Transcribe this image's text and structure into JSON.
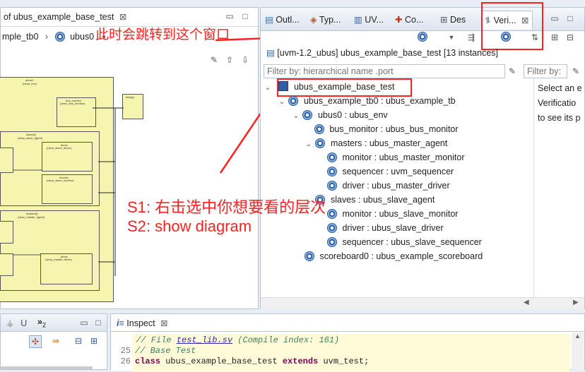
{
  "left_panel": {
    "tab_title": "of ubus_example_base_test",
    "breadcrumb_1": "mple_tb0",
    "breadcrumb_2": "ubus0",
    "diagram": {
      "env_label": "ubus0",
      "env_sub": "(ubus_env)",
      "bus_monitor": "bus_monitor",
      "bus_monitor_sub": "(ubus_bus_monitor)",
      "design": "design",
      "slaves_label": "slaves[]",
      "slaves_sub": "(ubus_slave_agent)",
      "driver": "driver",
      "slave_driver_sub": "(ubus_slave_driver)",
      "monitor": "monitor",
      "slave_monitor_sub": "(ubus_slave_monitor)",
      "masters_label": "masters[]",
      "masters_sub": "(ubus_master_agent)",
      "master_driver_sub": "(ubus_master_driver)"
    }
  },
  "right_panel": {
    "tabs": [
      "Outl...",
      "Typ...",
      "UV...",
      "Co...",
      "Des",
      "Veri..."
    ],
    "header": "[uvm-1.2_ubus] ubus_example_base_test [13 instances]",
    "filter_placeholder": "Filter by: hierarchical name .port",
    "filter2_placeholder": "Filter by: i",
    "tree": [
      "ubus_example_base_test",
      "ubus_example_tb0 : ubus_example_tb",
      "ubus0 : ubus_env",
      "bus_monitor : ubus_bus_monitor",
      "masters : ubus_master_agent",
      "monitor : ubus_master_monitor",
      "sequencer : uvm_sequencer",
      "driver : ubus_master_driver",
      "slaves : ubus_slave_agent",
      "monitor : ubus_slave_monitor",
      "driver : ubus_slave_driver",
      "sequencer : ubus_slave_sequencer",
      "scoreboard0 : ubus_example_scoreboard"
    ],
    "side_text": [
      "Select an e",
      "Verificatio",
      "to see its p"
    ]
  },
  "annotations": {
    "top": "此时会跳转到这个窗口",
    "s1": "S1: 右击选中你想要看的层次",
    "s2": "S2: show diagram"
  },
  "bottom_left": {
    "tab1": "U",
    "tab2": "»",
    "tab2_sub": "2"
  },
  "inspect": {
    "tab": "Inspect",
    "lines": [
      {
        "num": "",
        "text": "// File test_lib.sv (Compile index: 161)"
      },
      {
        "num": "25",
        "text": "// Base Test"
      },
      {
        "num": "26",
        "kw1": "class",
        "text": " ubus_example_base_test ",
        "kw2": "extends",
        "text2": " uvm_test;"
      }
    ],
    "file_link": "test_lib.sv"
  },
  "colors": {
    "annotation_red": "#ff2222",
    "diagram_fill": "#f5f5b0",
    "keyword": "#7f0055",
    "comment": "#3f7f5f"
  }
}
